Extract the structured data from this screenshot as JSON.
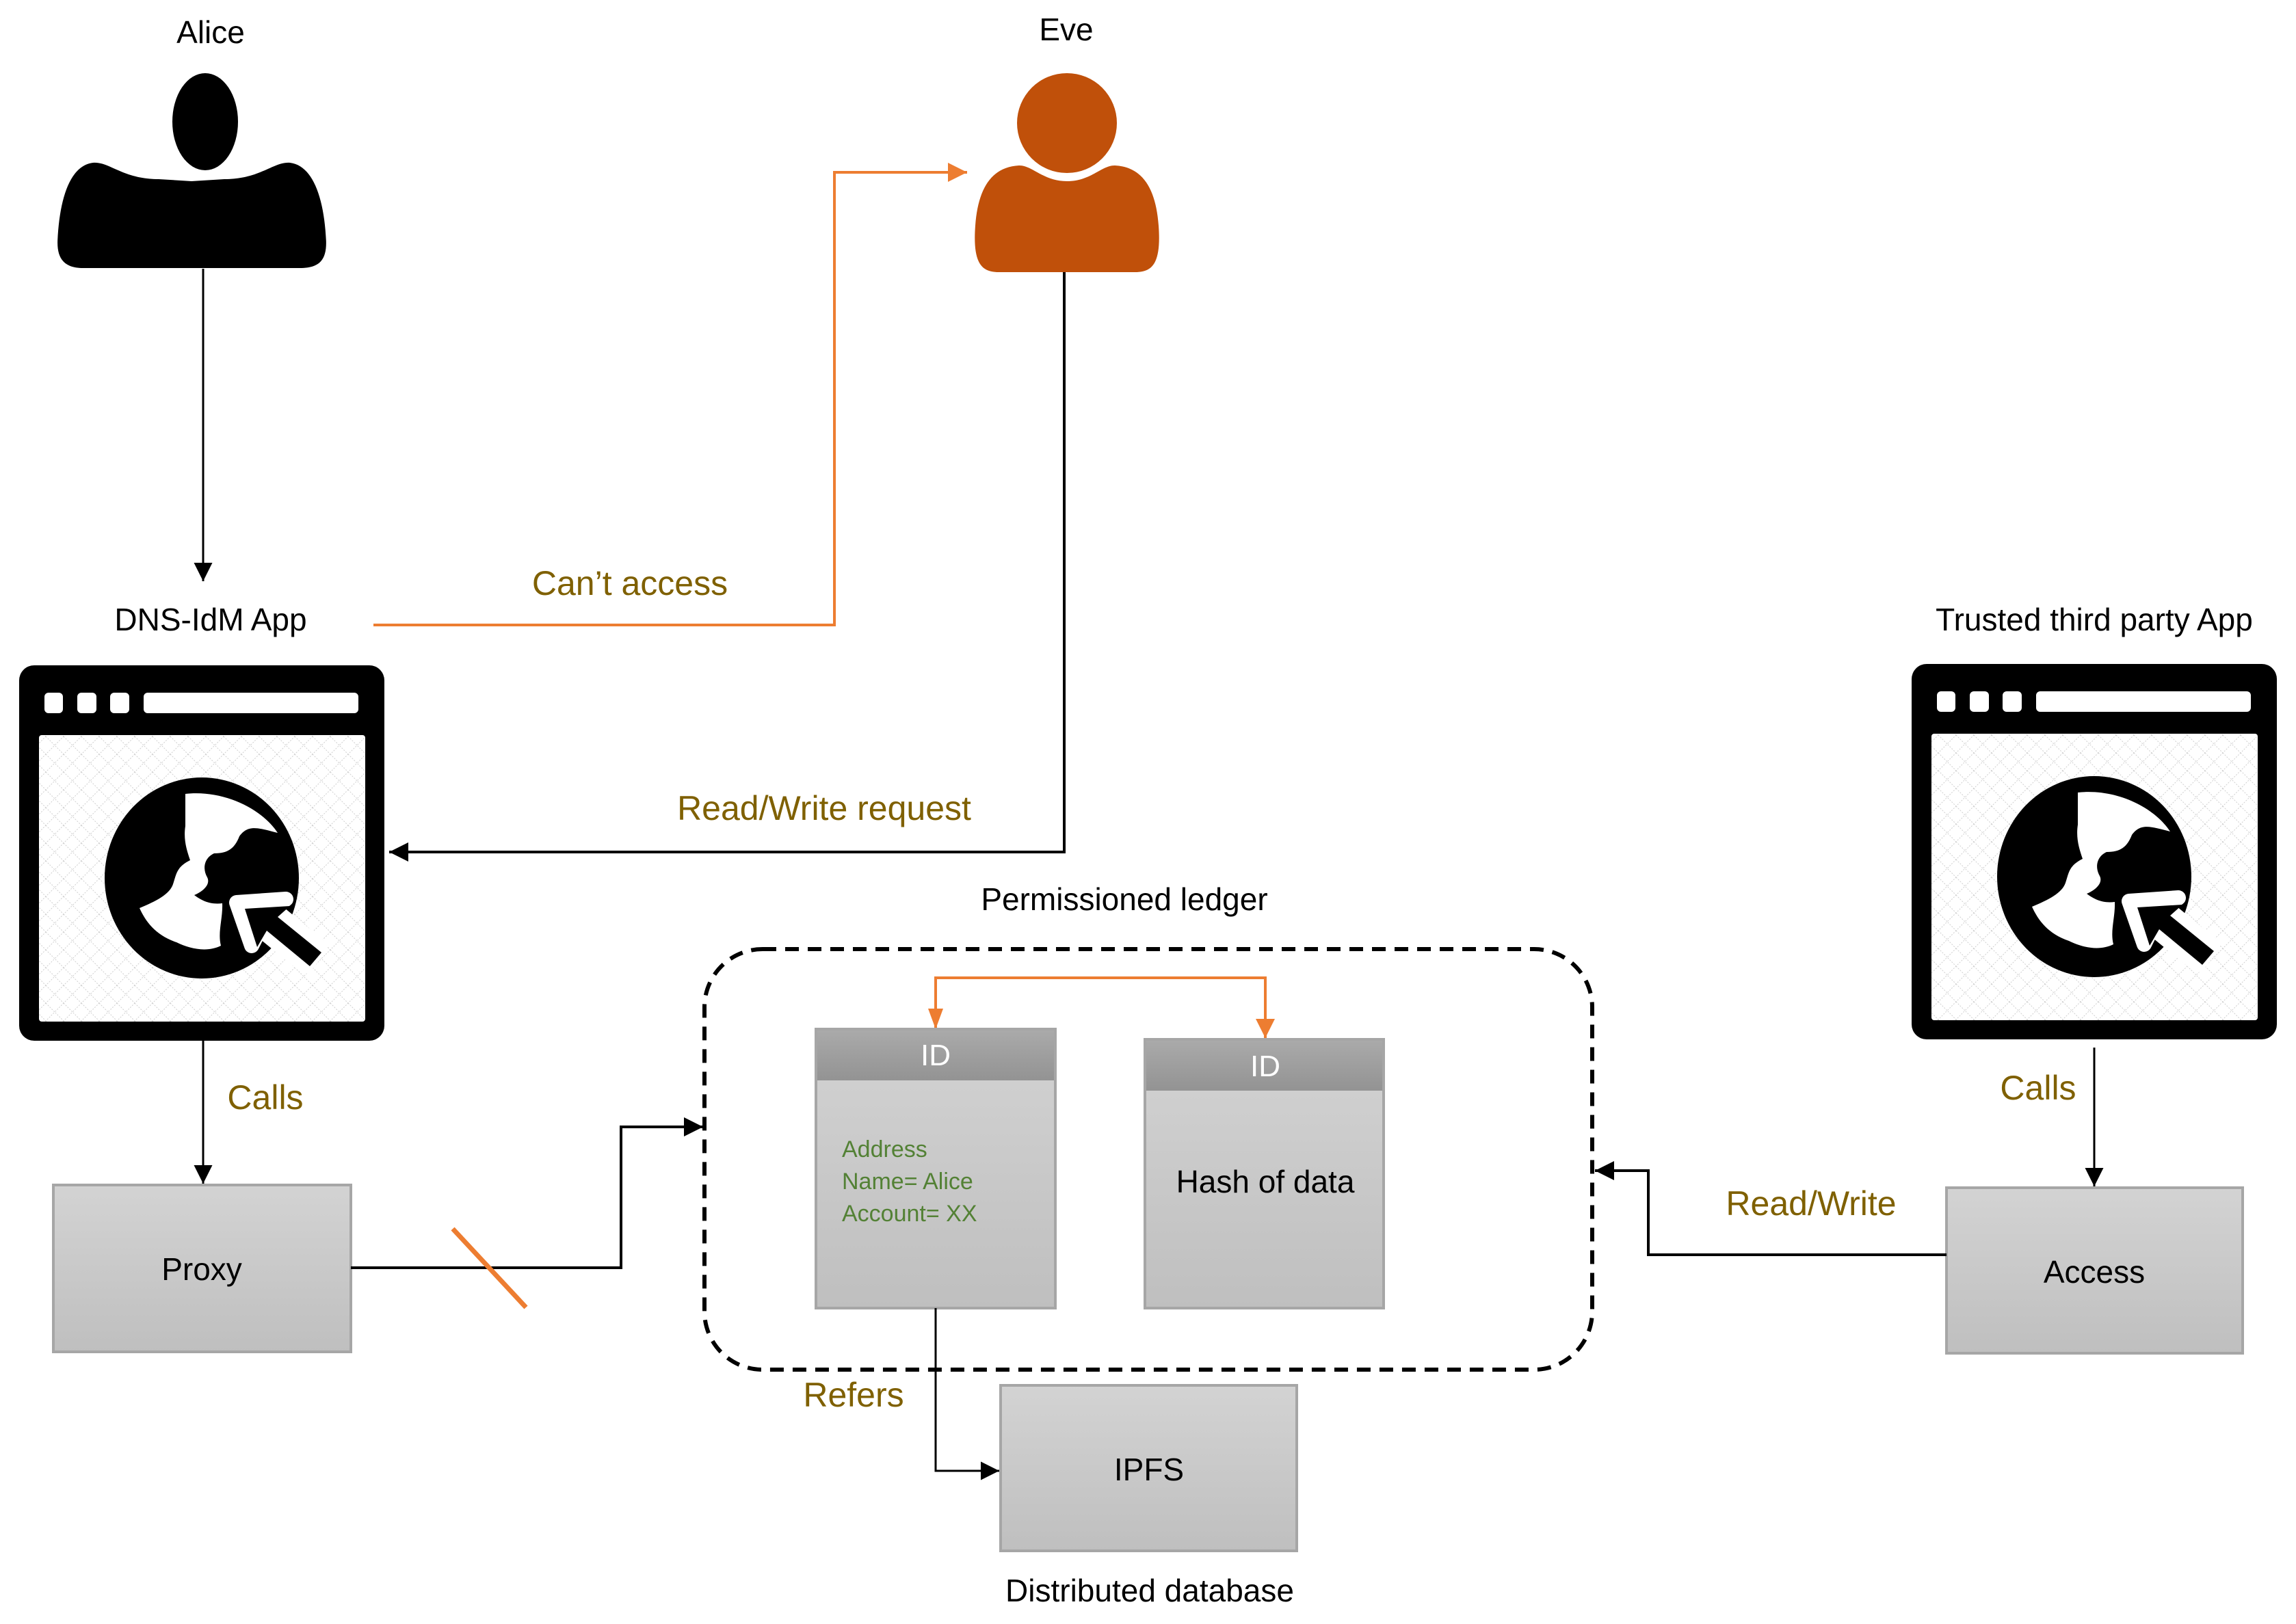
{
  "diagram": {
    "actors": {
      "alice": {
        "label": "Alice",
        "icon": "person-icon",
        "color": "#000000"
      },
      "eve": {
        "label": "Eve",
        "icon": "person-icon",
        "color": "#c0500a"
      }
    },
    "apps": {
      "dns_idm": {
        "label": "DNS-IdM App",
        "icon": "browser-globe-icon"
      },
      "trusted_third_party": {
        "label": "Trusted third party App",
        "icon": "browser-globe-icon"
      }
    },
    "components": {
      "proxy": {
        "label": "Proxy"
      },
      "access": {
        "label": "Access"
      },
      "ipfs": {
        "label": "IPFS",
        "caption": "Distributed database"
      }
    },
    "ledger": {
      "label": "Permissioned ledger",
      "records": [
        {
          "header": "ID",
          "lines": [
            "Address",
            "Name= Alice",
            "Account= XX"
          ],
          "text_color": "#538135"
        },
        {
          "header": "ID",
          "lines": [
            "Hash of data"
          ],
          "text_color": "#000000"
        }
      ]
    },
    "edges": {
      "cant_access": "Can’t access",
      "read_write_request": "Read/Write request",
      "calls_left": "Calls",
      "calls_right": "Calls",
      "read_write": "Read/Write",
      "refers": "Refers"
    },
    "colors": {
      "edge_label": "#7f6000",
      "orange_accent": "#ed7d31",
      "eve": "#c0500a",
      "box_fill_top": "#d3d3d3",
      "box_fill_bottom": "#bfbfbf",
      "box_border": "#a6a6a6",
      "header_fill": "#a0a0a0",
      "record_text_green": "#538135"
    }
  }
}
